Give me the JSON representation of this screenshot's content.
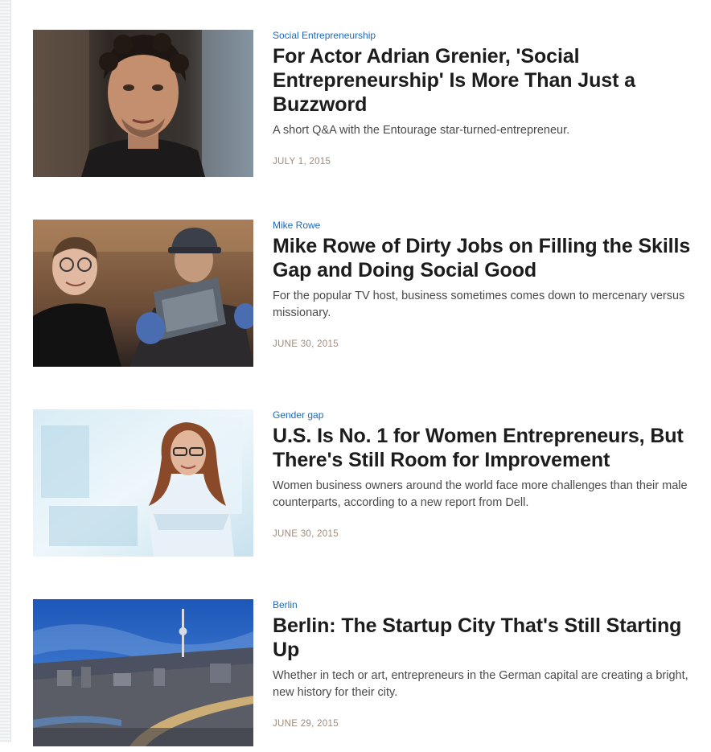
{
  "articles": [
    {
      "category": "Social Entrepreneurship",
      "headline": "For Actor Adrian Grenier, 'Social Entrepreneurship' Is More Than Just a Buzzword",
      "dek": "A short Q&A with the Entourage star-turned-entrepreneur.",
      "date": "JULY 1, 2015"
    },
    {
      "category": "Mike Rowe",
      "headline": "Mike Rowe of Dirty Jobs on Filling the Skills Gap and Doing Social Good",
      "dek": "For the popular TV host, business sometimes comes down to mercenary versus missionary.",
      "date": "JUNE 30, 2015"
    },
    {
      "category": "Gender gap",
      "headline": "U.S. Is No. 1 for Women Entrepreneurs, But There's Still Room for Improvement",
      "dek": "Women business owners around the world face more challenges than their male counterparts, according to a new report from Dell.",
      "date": "JUNE 30, 2015"
    },
    {
      "category": "Berlin",
      "headline": "Berlin: The Startup City That's Still Starting Up",
      "dek": "Whether in tech or art, entrepreneurs in the German capital are creating a bright, new history for their city.",
      "date": "JUNE 29, 2015"
    }
  ]
}
